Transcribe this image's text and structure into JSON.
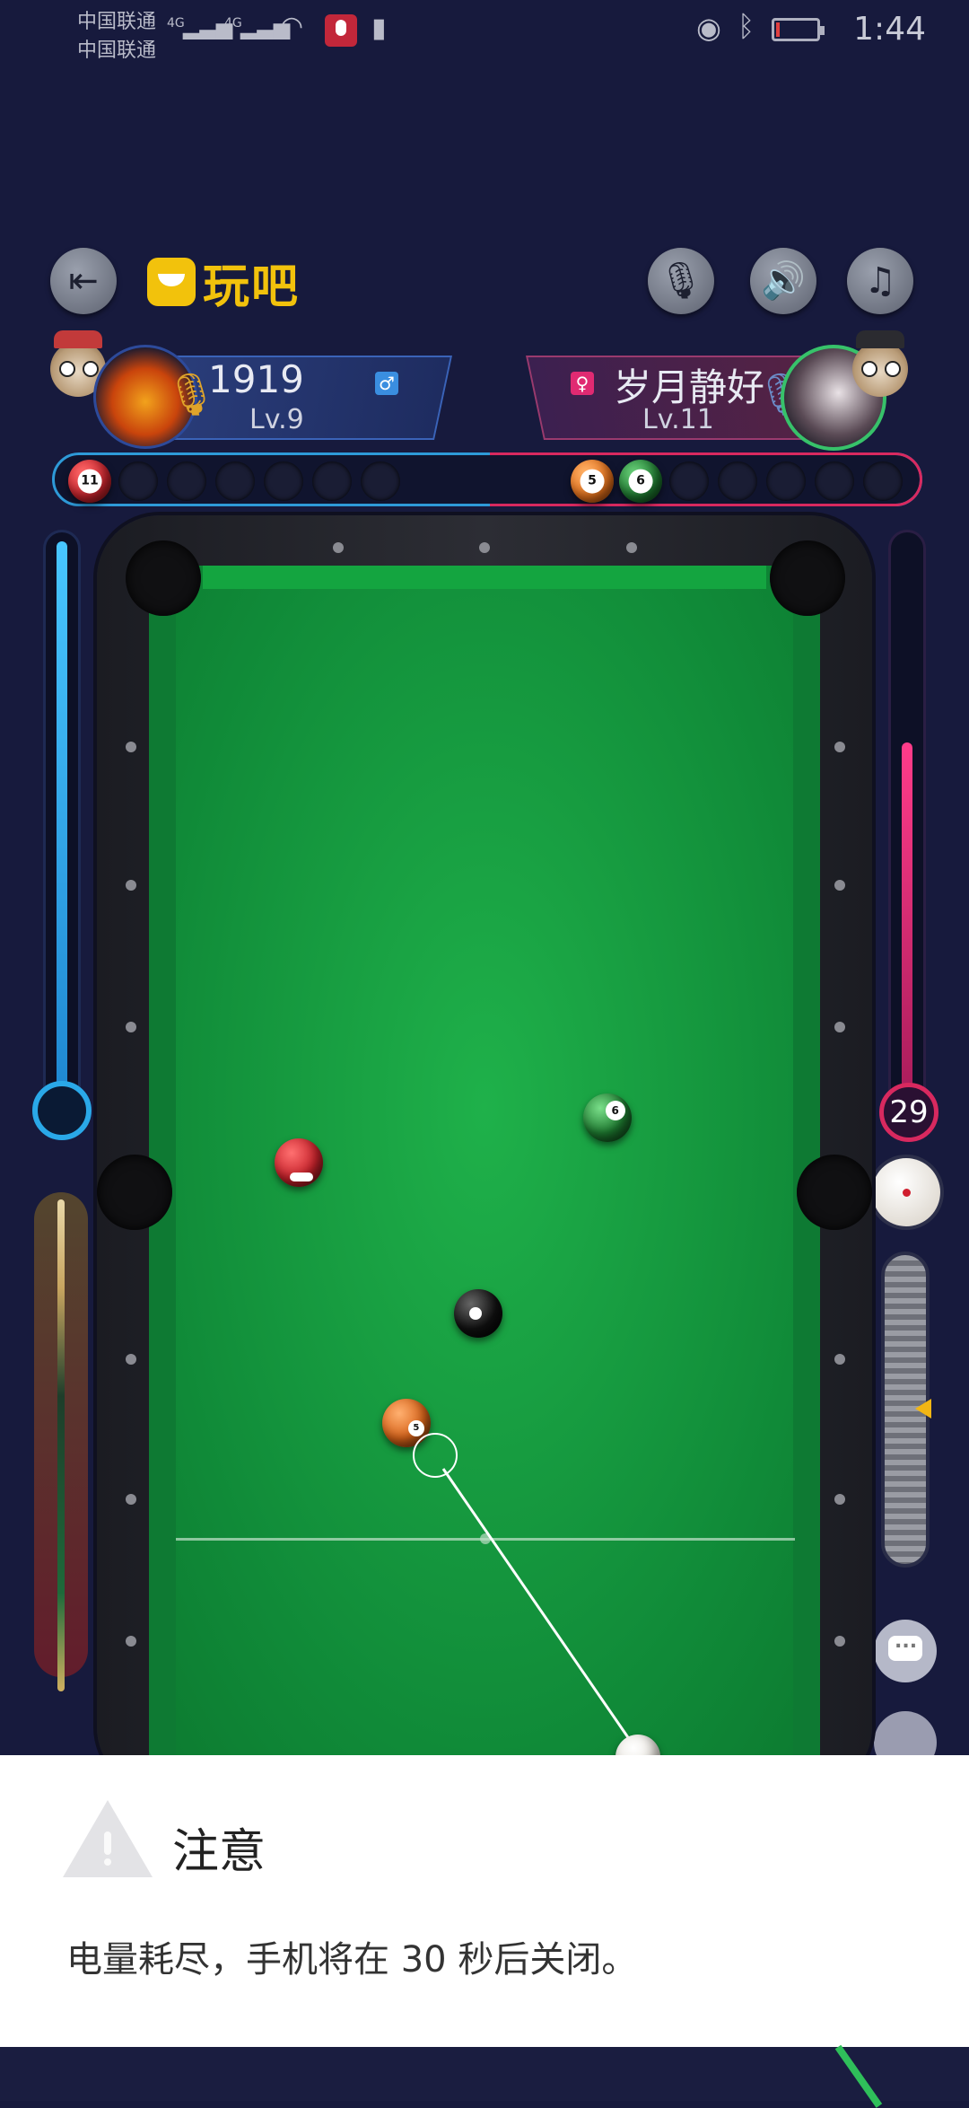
{
  "status_bar": {
    "carrier_1": "中国联通",
    "carrier_2": "中国联通",
    "network_1": "4G",
    "network_2": "4G",
    "time": "1:44",
    "icons": [
      "signal-icon",
      "wifi-icon",
      "mic-recording-icon",
      "battery-alert-icon",
      "eye-icon",
      "bluetooth-icon",
      "battery-icon"
    ]
  },
  "top_bar": {
    "logo_text": "玩吧",
    "icons": [
      "exit-icon",
      "microphone-icon",
      "speaker-icon",
      "music-icon"
    ]
  },
  "players": {
    "left": {
      "name": "1919",
      "level": "Lv.9",
      "gender_symbol": "♂",
      "color": "#2e9ad8"
    },
    "right": {
      "name": "岁月静好",
      "level": "Lv.11",
      "gender_symbol": "♀",
      "color": "#d8295f"
    }
  },
  "racks": {
    "left_balls": [
      {
        "number": "11",
        "color": "#c8232c"
      }
    ],
    "right_balls": [
      {
        "number": "5",
        "color": "#e8731c"
      },
      {
        "number": "6",
        "color": "#1e7a30"
      }
    ]
  },
  "controls": {
    "power_value": "29",
    "power_level_left": 1.0,
    "power_level_right": 0.6
  },
  "table_balls": [
    {
      "id": "ball-6-green",
      "color": "#1e7a30"
    },
    {
      "id": "ball-11-red",
      "color": "#c8232c"
    },
    {
      "id": "ball-8-black",
      "color": "#111111"
    },
    {
      "id": "ball-5-orange",
      "color": "#e8731c"
    },
    {
      "id": "cue-ball",
      "color": "#f4f1ea"
    }
  ],
  "dialog": {
    "title": "注意",
    "message": "电量耗尽，手机将在 30 秒后关闭。"
  }
}
